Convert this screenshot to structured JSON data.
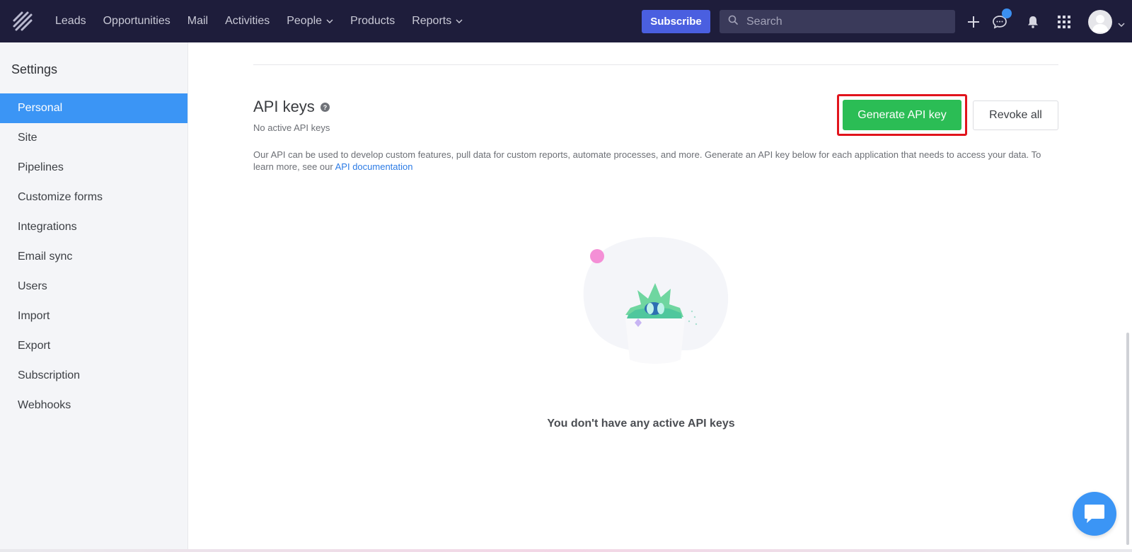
{
  "nav": {
    "items": [
      {
        "label": "Leads",
        "has_dropdown": false
      },
      {
        "label": "Opportunities",
        "has_dropdown": false
      },
      {
        "label": "Mail",
        "has_dropdown": false
      },
      {
        "label": "Activities",
        "has_dropdown": false
      },
      {
        "label": "People",
        "has_dropdown": true
      },
      {
        "label": "Products",
        "has_dropdown": false
      },
      {
        "label": "Reports",
        "has_dropdown": true
      }
    ],
    "subscribe_label": "Subscribe",
    "search_placeholder": "Search",
    "icons": [
      "plus-icon",
      "chat-icon",
      "bell-icon",
      "apps-grid-icon",
      "avatar"
    ],
    "colors": {
      "background": "#1e1d3b",
      "subscribe": "#4a5fe0"
    }
  },
  "sidebar": {
    "title": "Settings",
    "items": [
      {
        "label": "Personal",
        "active": true
      },
      {
        "label": "Site",
        "active": false
      },
      {
        "label": "Pipelines",
        "active": false
      },
      {
        "label": "Customize forms",
        "active": false
      },
      {
        "label": "Integrations",
        "active": false
      },
      {
        "label": "Email sync",
        "active": false
      },
      {
        "label": "Users",
        "active": false
      },
      {
        "label": "Import",
        "active": false
      },
      {
        "label": "Export",
        "active": false
      },
      {
        "label": "Subscription",
        "active": false
      },
      {
        "label": "Webhooks",
        "active": false
      }
    ],
    "active_color": "#3b95f5"
  },
  "main": {
    "section_title": "API keys",
    "section_subtitle": "No active API keys",
    "generate_label": "Generate API key",
    "revoke_label": "Revoke all",
    "description_text": "Our API can be used to develop custom features, pull data for custom reports, automate processes, and more. Generate an API key below for each application that needs to access your data. To learn more, see our ",
    "description_link": "API documentation",
    "empty_state": "You don't have any active API keys",
    "colors": {
      "generate": "#2bbd55",
      "highlight_outline": "#e1141c",
      "link": "#2c7be5"
    }
  }
}
